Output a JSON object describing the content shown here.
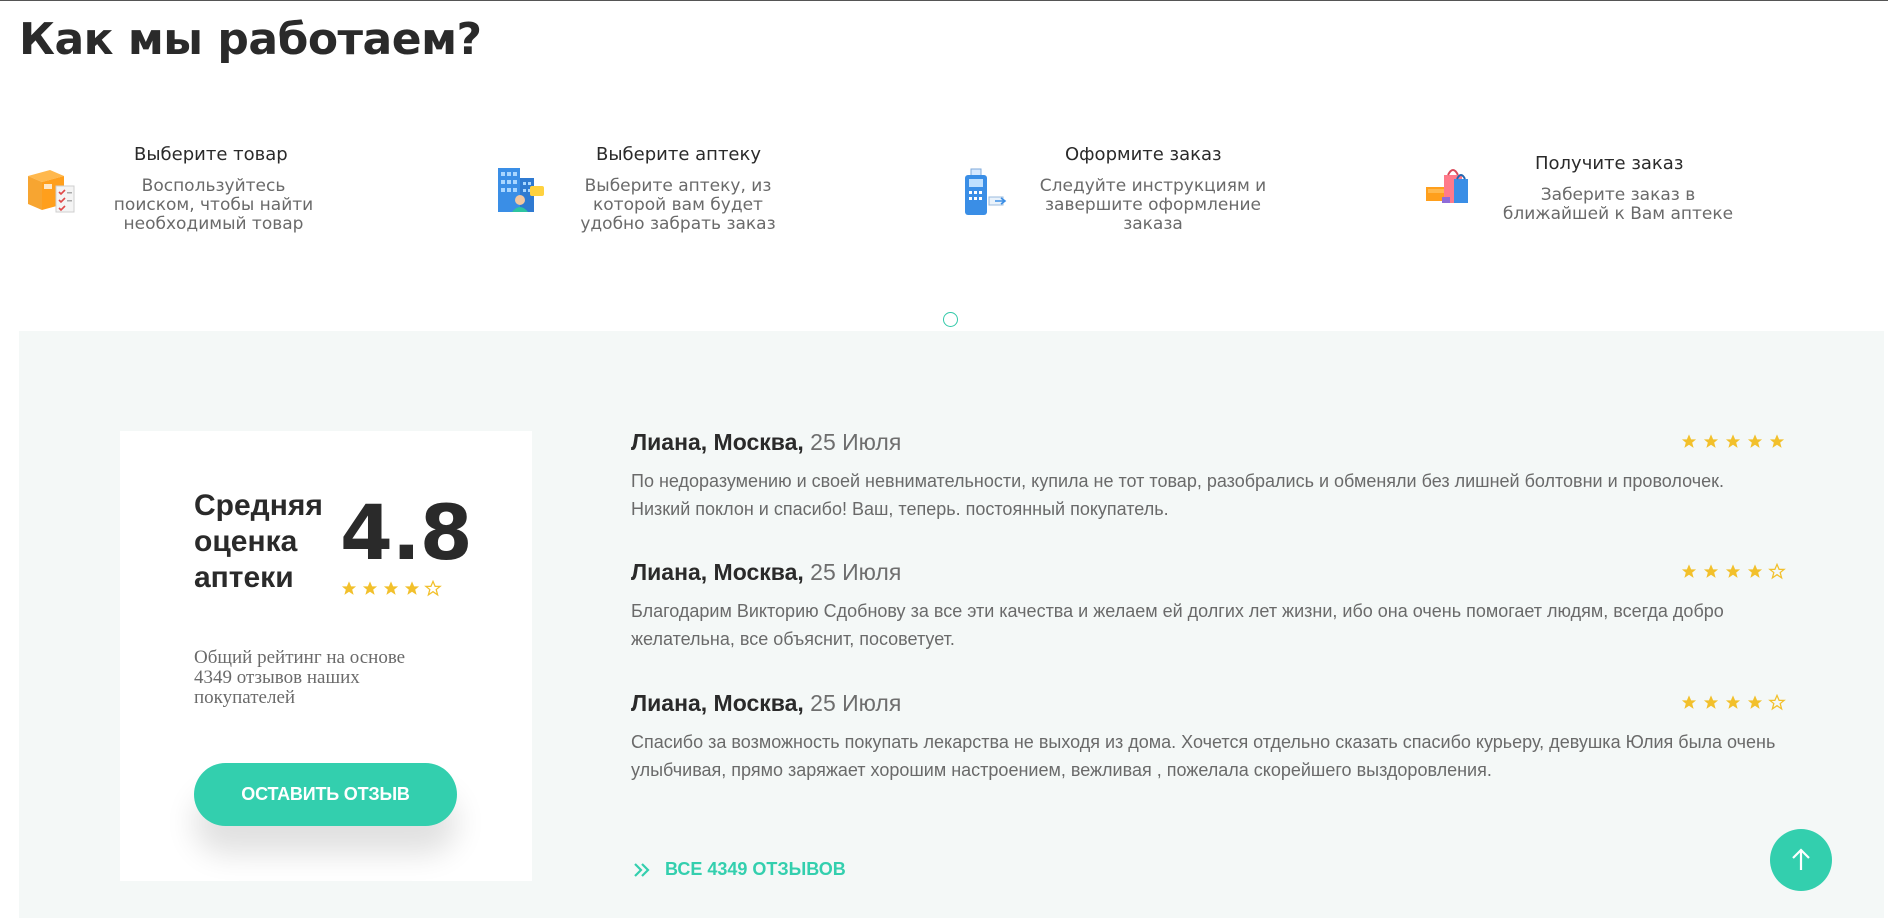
{
  "page_title": "Как мы работаем?",
  "steps": [
    {
      "icon": "box-checklist-icon",
      "title": "Выберите товар",
      "text": "Воспользуйтесь поиском, чтобы найти необходимый товар"
    },
    {
      "icon": "pharmacy-building-icon",
      "title": "Выберите аптеку",
      "text": "Выберите аптеку, из которой вам будет удобно забрать заказ"
    },
    {
      "icon": "payment-terminal-icon",
      "title": "Оформите заказ",
      "text": "Следуйте инструкциям и завершите оформление заказа"
    },
    {
      "icon": "shopping-bags-icon",
      "title": "Получите заказ",
      "text": "Заберите заказ в ближайшей к Вам аптеке"
    }
  ],
  "rating": {
    "label": "Средняя оценка аптеки",
    "value": "4.8",
    "stars": 4,
    "note": "Общий рейтинг на основе 4349 отзывов наших покупателей",
    "button": "ОСТАВИТЬ ОТЗЫВ"
  },
  "reviews": [
    {
      "author": "Лиана, Москва,",
      "date": "25 Июля",
      "stars": 5,
      "text": "По недоразумению и своей невнимательности, купила не тот товар, разобрались и обменяли без лишней болтовни и проволочек. Низкий поклон и спасибо! Ваш, теперь. постоянный покупатель."
    },
    {
      "author": "Лиана, Москва,",
      "date": "25 Июля",
      "stars": 4,
      "text": "Благодарим Викторию Сдобнову за все эти качества и желаем ей долгих лет жизни, ибо она очень помогает людям, всегда добро желательна, все объяснит, посоветует."
    },
    {
      "author": "Лиана, Москва,",
      "date": "25 Июля",
      "stars": 4,
      "text": "Спасибо за возможность покупать лекарства не выходя из дома. Хочется отдельно сказать спасибо курьеру, девушка Юлия была очень улыбчивая, прямо заряжает хорошим настроением, вежливая , пожелала скорейшего выздоровления."
    }
  ],
  "all_reviews": "ВСЕ 4349 ОТЗЫВОВ",
  "colors": {
    "accent": "#33cfae",
    "star": "#f2c02b",
    "section_bg": "#f4f8f7"
  }
}
